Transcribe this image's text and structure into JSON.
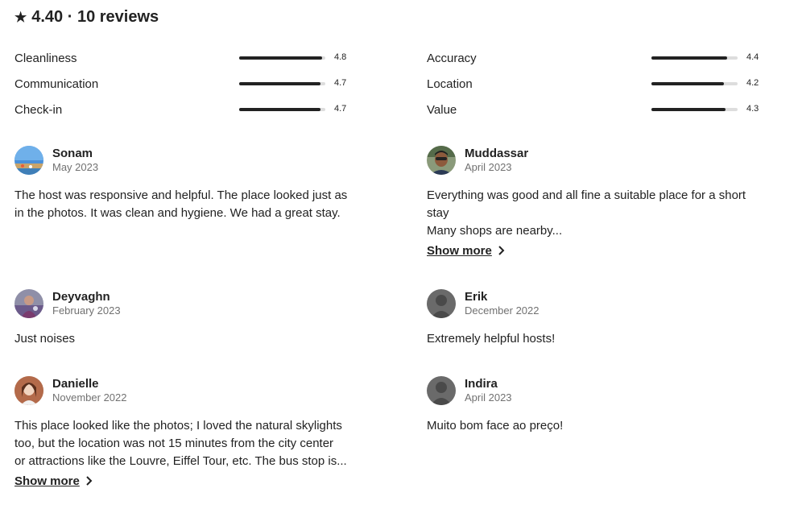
{
  "summary": {
    "text": "4.40 · 10 reviews"
  },
  "ratings": [
    {
      "label": "Cleanliness",
      "score": "4.8",
      "value": 4.8
    },
    {
      "label": "Communication",
      "score": "4.7",
      "value": 4.7
    },
    {
      "label": "Check-in",
      "score": "4.7",
      "value": 4.7
    },
    {
      "label": "Accuracy",
      "score": "4.4",
      "value": 4.4
    },
    {
      "label": "Location",
      "score": "4.2",
      "value": 4.2
    },
    {
      "label": "Value",
      "score": "4.3",
      "value": 4.3
    }
  ],
  "reviews": [
    {
      "name": "Sonam",
      "date": "May 2023",
      "text": "The host was responsive and helpful. The place looked just as\nin the photos. It was clean and hygiene. We had a great stay."
    },
    {
      "name": "Muddassar",
      "date": "April 2023",
      "text": "Everything was good and all fine a suitable place for a short\nstay\nMany shops are nearby...",
      "show_more": "Show more"
    },
    {
      "name": "Deyvaghn",
      "date": "February 2023",
      "text": "Just noises"
    },
    {
      "name": "Erik",
      "date": "December 2022",
      "text": "Extremely helpful hosts!"
    },
    {
      "name": "Danielle",
      "date": "November 2022",
      "text": "This place looked like the photos; I loved the natural skylights\ntoo, but the location was not 15 minutes from the city center\nor attractions like the Louvre, Eiffel Tour, etc. The bus stop is...",
      "show_more": "Show more"
    },
    {
      "name": "Indira",
      "date": "April 2023",
      "text": "Muito bom face ao preço!"
    }
  ]
}
